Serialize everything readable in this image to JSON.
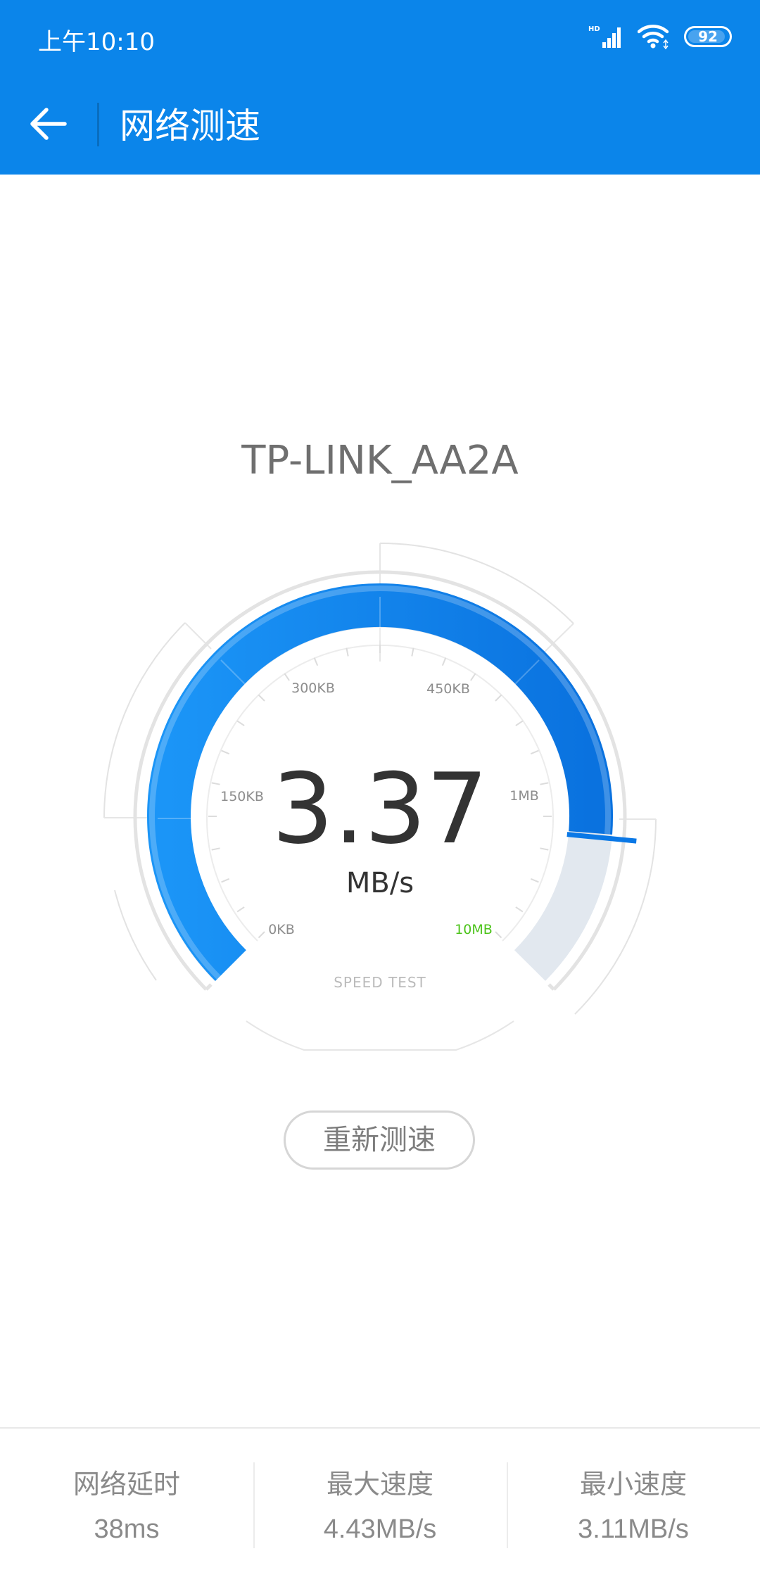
{
  "status_bar": {
    "time": "上午10:10",
    "network_badge": "HD",
    "battery_level": 92,
    "battery_text": "92"
  },
  "header": {
    "title": "网络测速",
    "back_icon": "arrow-left-icon",
    "background_color": "#0b85ea"
  },
  "gauge": {
    "network_name": "TP-LINK_AA2A",
    "speed_value": "3.37",
    "speed_unit": "MB/s",
    "caption": "SPEED TEST",
    "progress_fraction": 0.85,
    "scale_labels": {
      "zero": "0KB",
      "low": "150KB",
      "mid_low": "300KB",
      "mid_high": "450KB",
      "high": "1MB",
      "max": "10MB"
    },
    "arc_color": "#1a7fe8",
    "track_color": "#e2e8ef",
    "max_label_color": "#4cc31a"
  },
  "actions": {
    "retest_label": "重新测速"
  },
  "stats": {
    "latency": {
      "label": "网络延时",
      "value": "38ms"
    },
    "max_speed": {
      "label": "最大速度",
      "value": "4.43MB/s"
    },
    "min_speed": {
      "label": "最小速度",
      "value": "3.11MB/s"
    }
  }
}
